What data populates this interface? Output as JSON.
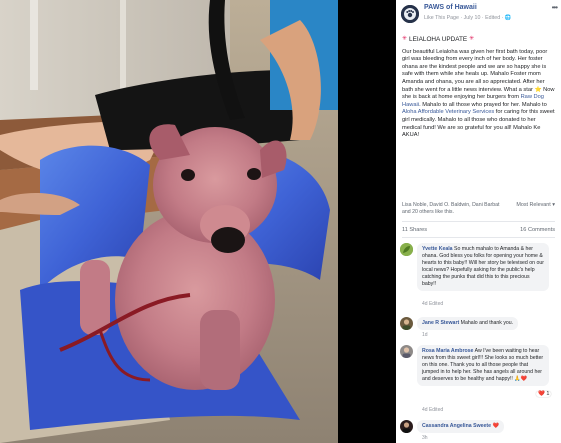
{
  "post": {
    "page_name": "PAWS of Hawaii",
    "meta": "Like This Page · July 10 · Edited · ",
    "more_label": "•••",
    "title": "LEIALOHA UPDATE",
    "body_1": "Our beautiful Leialoha was given her first bath today, poor girl was bleeding from every inch of her body. Her foster ohana are the kindest people and we are so happy she is safe with them while she heals up. Mahalo Foster mom Amanda and ohana, you are all so appreciated. After her bath she went for a little news interview. What a star ",
    "star_emoji": "⭐",
    "body_2": " Now she is back at home enjoying her burgers from ",
    "link_1": "Raw Dog Hawaii",
    "body_3": ". Mahalo to all those who prayed for her. Mahalo to ",
    "link_2": "Aloha Affordable Veterinary Services",
    "body_4": " for caring for this sweet girl medically. Mahalo to all those who donated to her medical fund! We are so grateful for you all! Mahalo Ke AKUA!",
    "likes": "Lisa Noble, David O. Baldwin, Dani Barbat and 20 others like this.",
    "most_relevant": "Most Relevant ▾",
    "comment_count": "11 Shares",
    "share_count": "16 Comments"
  },
  "comments": [
    {
      "name": "Yvette Keala",
      "text": " So much mahalo to Amanda & her ohana. God bless you folks for opening your home & hearts to this baby!! Will her story be televised on our local news? Hopefully asking for the public's help catching the punks that did this to this precious baby!!",
      "actions": "4d   Edited"
    },
    {
      "name": "Jane R Stewart",
      "text": " Mahalo and thank you.",
      "actions": "1d"
    },
    {
      "name": "Rosa Maria Ambrose",
      "text": " Aw I've been waiting to hear news from this sweet girl!!! She looks so much better on this one. Thank you to all those people that jumped in to help her. She has angels all around her and deserves to be healthy and happy!! ",
      "emoji_end": "🙏❤️",
      "reactions": "❤️ 1",
      "actions": "4d   Edited"
    },
    {
      "name": "Cassandra Angelina Sweete",
      "emoji_end": "❤️",
      "actions": "3h"
    }
  ],
  "colors": {
    "link": "#385898",
    "meta": "#90949c",
    "bubble": "#f2f3f5",
    "towel": "#3f63d6"
  }
}
